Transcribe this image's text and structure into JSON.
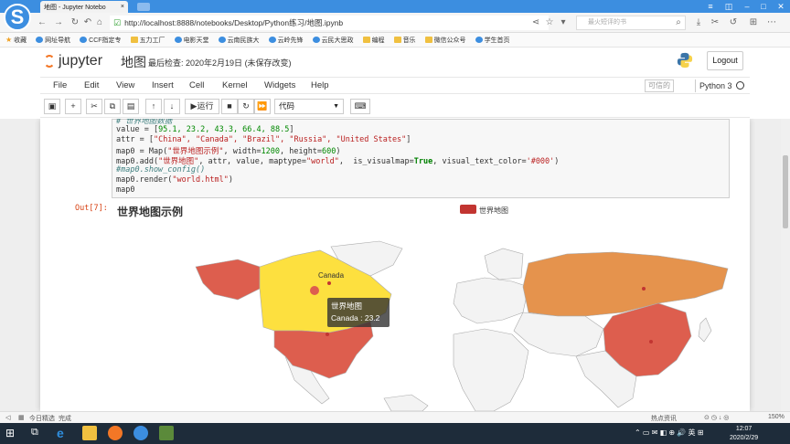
{
  "browser": {
    "tab_title": "地图 - Jupyter Notebo",
    "url": "http://localhost:8888/notebooks/Desktop/Python练习/地图.ipynb",
    "search_placeholder": "最火短评的书",
    "brand_letter": "S"
  },
  "bookmarks": [
    "收藏",
    "网址导航",
    "CCF指定专",
    "五力工厂",
    "电影天堂",
    "云南民族大",
    "云岭先锋",
    "云民大思政",
    "编程",
    "音乐",
    "微信公众号",
    "学生首页"
  ],
  "jupyter": {
    "logo_text": "jupyter",
    "notebook_title": "地图",
    "checkpoint_text": "最后检查: 2020年2月19日",
    "unsaved_text": "(未保存改变)",
    "logout_label": "Logout",
    "menus": [
      "File",
      "Edit",
      "View",
      "Insert",
      "Cell",
      "Kernel",
      "Widgets",
      "Help"
    ],
    "trusted_label": "可信的",
    "kernel_name": "Python 3",
    "run_label": "运行",
    "cell_type": "代码"
  },
  "code_lines": {
    "l0": "# 世界地图数据",
    "l1_a": "value = [",
    "l1_b": "95.1, 23.2, 43.3, 66.4, 88.5",
    "l1_c": "]",
    "l2_a": "attr = [",
    "l2_b": "\"China\", \"Canada\", \"Brazil\", \"Russia\", \"United States\"",
    "l2_c": "]",
    "l3_a": "map0 = Map(",
    "l3_b": "\"世界地图示例\"",
    "l3_c": ", width=",
    "l3_d": "1200",
    "l3_e": ", height=",
    "l3_f": "600",
    "l3_g": ")",
    "l4_a": "map0.add(",
    "l4_b": "\"世界地图\"",
    "l4_c": ", attr, value, maptype=",
    "l4_d": "\"world\"",
    "l4_e": ",  is_visualmap=",
    "l4_f": "True",
    "l4_g": ", visual_text_color=",
    "l4_h": "'#000'",
    "l4_i": ")",
    "l5": "#map0.show_config()",
    "l6_a": "map0.render(",
    "l6_b": "\"world.html\"",
    "l6_c": ")",
    "l7": "map0"
  },
  "output": {
    "prompt": "Out[7]:",
    "chart_title": "世界地图示例",
    "legend_label": "世界地图",
    "canada_label": "Canada",
    "tooltip_series": "世界地图",
    "tooltip_value": "Canada : 23.2"
  },
  "chart_data": {
    "type": "map",
    "title": "世界地图示例",
    "series": [
      {
        "name": "世界地图",
        "categories": [
          "China",
          "Canada",
          "Brazil",
          "Russia",
          "United States"
        ],
        "values": [
          95.1,
          23.2,
          43.3,
          66.4,
          88.5
        ]
      }
    ]
  },
  "status": {
    "left1": "今日精选",
    "left2": "完成",
    "right1": "热点资讯",
    "zoom": "150%"
  },
  "clock": {
    "time": "12:07",
    "date": "2020/2/29"
  },
  "colors": {
    "accent": "#3c8ee0",
    "legend": "#c23531",
    "china": "#dd5e4e",
    "usa": "#dd5e4e",
    "russia": "#e5934d",
    "canada": "#fde03f"
  }
}
